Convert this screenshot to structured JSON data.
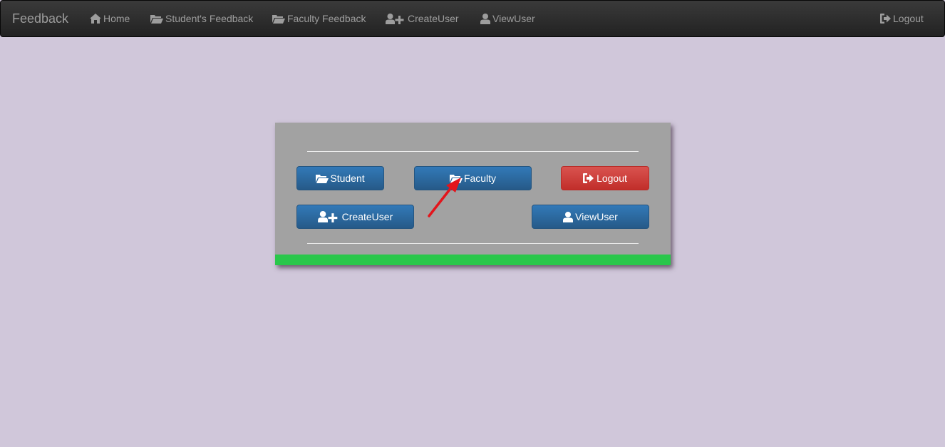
{
  "navbar": {
    "brand": "Feedback",
    "items": [
      {
        "label": "Home",
        "icon": "home-icon"
      },
      {
        "label": "Student's Feedback",
        "icon": "folder-open-icon"
      },
      {
        "label": "Faculty Feedback",
        "icon": "folder-open-icon"
      },
      {
        "label": "CreateUser",
        "icon": "add-user-icon"
      },
      {
        "label": "ViewUser",
        "icon": "user-icon"
      }
    ],
    "logout": {
      "label": "Logout",
      "icon": "logout-icon"
    }
  },
  "panel": {
    "buttons": {
      "student": {
        "label": "Student",
        "icon": "folder-open-icon"
      },
      "faculty": {
        "label": "Faculty",
        "icon": "folder-open-icon"
      },
      "logout": {
        "label": "Logout",
        "icon": "logout-icon"
      },
      "create_user": {
        "label": " CreateUser",
        "icon": "add-user-icon"
      },
      "view_user": {
        "label": "ViewUser",
        "icon": "user-icon"
      }
    }
  },
  "annotation": {
    "arrow_color": "#e3151c",
    "icon": "red-arrow-pointer"
  },
  "colors": {
    "page_bg": "#d0c7da",
    "navbar_bg": "#222222",
    "panel_bg": "#a2a2a2",
    "primary": "#337ab7",
    "danger": "#d9534f",
    "accent_bar": "#2ac74b"
  }
}
